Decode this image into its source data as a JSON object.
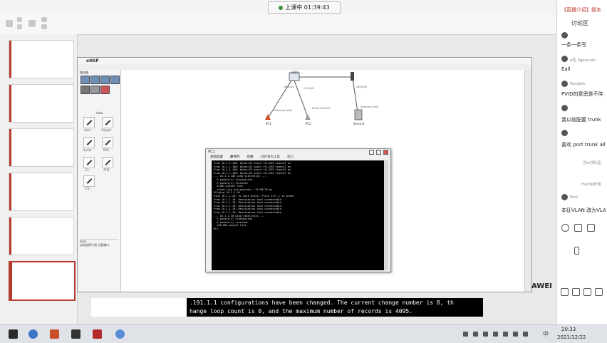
{
  "live_badge": {
    "text": "上课中 01:39:43"
  },
  "chat": {
    "header_label": "【直播介绍】题本",
    "title": "讨论区",
    "messages": [
      {
        "name": "",
        "text": "一条一条写"
      },
      {
        "name": "e性 Ilgeneato",
        "text": "Eall"
      },
      {
        "name": "Fecdeth",
        "text": "PVID的意思是不传"
      },
      {
        "name": "",
        "text": "我以前配置 trunk"
      },
      {
        "name": "",
        "text": "喜欢 port trunk all"
      },
      {
        "name": "",
        "text": "Fest"
      },
      {
        "name": "",
        "text": "本征VLAN 改为VLA"
      }
    ],
    "side_texts": [
      "对e对好话",
      "fnetTe好话"
    ]
  },
  "ensp": {
    "title": "eNSP",
    "palette": {
      "header": "路由器",
      "section_title": "Auto",
      "devices": [
        "Auto",
        "Copper",
        "Serial",
        "POS",
        "E1",
        "ATM",
        "CTL"
      ],
      "desc_title": "Auto",
      "desc_text": "自动选择介质 分配端口"
    },
    "topology": {
      "nodes": [
        "LSW1",
        "PC1",
        "PC2",
        "Server1"
      ],
      "links": [
        "GE 0/0/1",
        "Ethernet 0/0/1",
        "GE 0/0/2",
        "Ethernet 0/0/1",
        "GE 0/0/3",
        "Ethernet 0/0/0"
      ]
    }
  },
  "cli": {
    "title": "PC1",
    "tabs": [
      "基础配置",
      "命令行",
      "组播",
      "UDP发包工具",
      "串口"
    ],
    "lines": [
      "From 10.1.1.100: bytes=32 seq=2 ttl=255 time=47 ms",
      "From 10.1.1.100: bytes=32 seq=3 ttl=255 time=47 ms",
      "From 10.1.1.100: bytes=32 seq=4 ttl=255 time=62 ms",
      "From 10.1.1.100: bytes=32 seq=5 ttl=255 time=47 ms",
      "",
      "--- 10.1.1.100 ping statistics ---",
      "  5 packet(s) transmitted",
      "  5 packet(s) received",
      "  0.00% packet loss",
      "  round-trip min/avg/max = 31/50/78 ms",
      "",
      "PC>ping 10.1.1.20",
      "",
      "Ping 10.1.1.20: 32 data bytes, Press Ctrl_C to break",
      "From 10.1.1.10: Destination host unreachable",
      "From 10.1.1.10: Destination host unreachable",
      "From 10.1.1.10: Destination host unreachable",
      "From 10.1.1.10: Destination host unreachable",
      "From 10.1.1.10: Destination host unreachable",
      "",
      "--- 10.1.1.20 ping statistics ---",
      "  5 packet(s) transmitted",
      "  0 packet(s) received",
      "  100.00% packet loss",
      "",
      "PC>"
    ]
  },
  "caption": {
    "line1": ".191.1.1 configurations have been changed. The current change number is 8, th",
    "line2": "hange loop count is 0, and the maximum number of records is 4095."
  },
  "huawei_mark": "AWEI",
  "taskbar": {
    "time": "20:33",
    "date": "2021/12/22",
    "ime": "中"
  }
}
